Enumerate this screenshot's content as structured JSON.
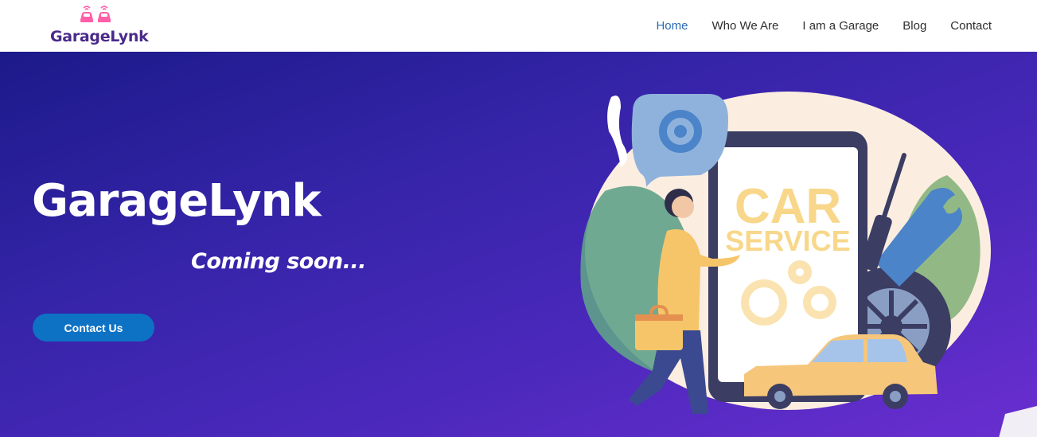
{
  "brand": {
    "logo_text": "GarageLynk",
    "logo_icon": "twin-cars-signal-icon",
    "logo_color": "#4a2a8a",
    "logo_accent": "#ff5fa8"
  },
  "nav": {
    "items": [
      {
        "label": "Home",
        "active": true
      },
      {
        "label": "Who We Are",
        "active": false
      },
      {
        "label": "I am a Garage",
        "active": false
      },
      {
        "label": "Blog",
        "active": false
      },
      {
        "label": "Contact",
        "active": false
      }
    ],
    "active_color": "#2a6bb5"
  },
  "hero": {
    "title": "GarageLynk",
    "subtitle": "Coming soon...",
    "cta_label": "Contact Us",
    "cta_color": "#0e72c4",
    "gradient": [
      "#1c1a8a",
      "#6a2ed0"
    ],
    "illustration": {
      "phone_heading": "CAR",
      "phone_subheading": "SERVICE",
      "text_color": "#f8d78a",
      "icons": [
        "gear-bubble-icon",
        "wrench-icon",
        "screwdriver-icon",
        "tire-icon",
        "toolbox-icon",
        "taxi-car-icon",
        "mechanic-person-icon"
      ]
    }
  }
}
